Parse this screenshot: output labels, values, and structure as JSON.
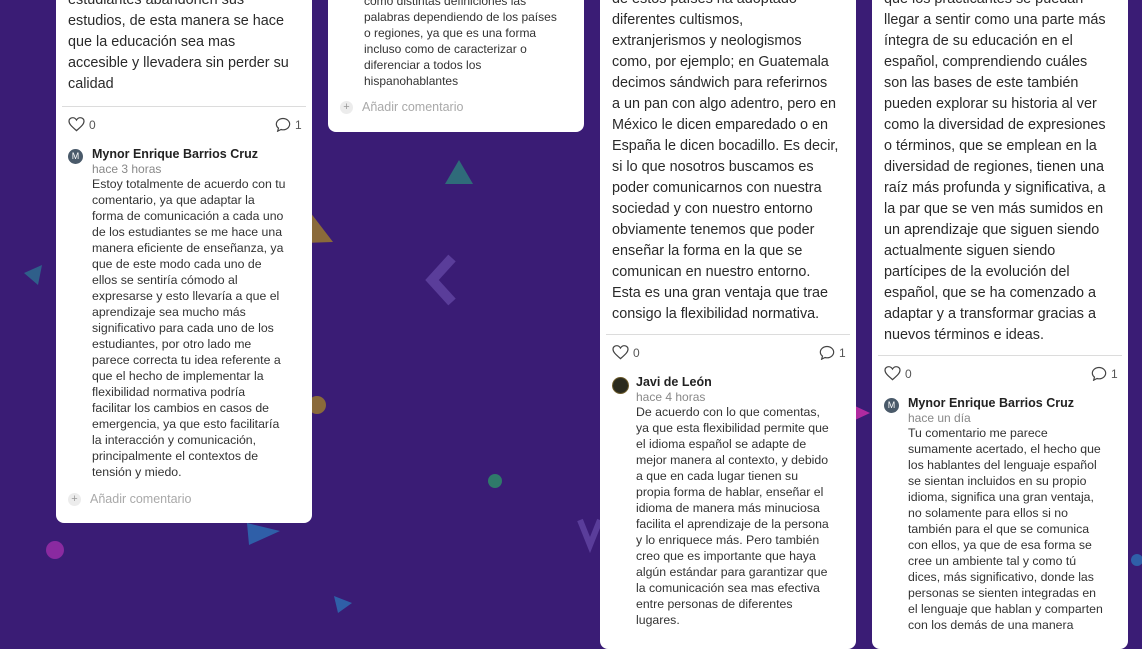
{
  "colors": {
    "background": "#3a1c75",
    "card": "#ffffff"
  },
  "cards": [
    {
      "text": "estudiantes abandonen sus\nestudios, de esta manera se hace\nque la educación sea mas\naccesible y llevadera sin perder su\ncalidad",
      "likes": "0",
      "comments_count": "1",
      "comment": {
        "avatar": "M",
        "author": "Mynor Enrique Barrios Cruz",
        "time": "hace 3 horas",
        "text": "Estoy totalmente de acuerdo con tu\ncomentario, ya que adaptar la\nforma de comunicación a cada uno\nde los estudiantes se me hace una\nmanera eficiente de enseñanza, ya\nque de este modo cada uno de\nellos se sentiría cómodo al\nexpresarse y esto llevaría a que el\naprendizaje sea  mucho más\nsignificativo para cada uno de los\nestudiantes, por otro lado me\nparece correcta tu idea referente a\nque el hecho de implementar la\nflexibilidad normativa podría\nfacilitar los cambios en casos de\nemergencia, ya que esto facilitaría\nla interacción y comunicación,\nprincipalmente el contextos de\ntensión y miedo."
      },
      "add_comment": "Añadir comentario"
    },
    {
      "text": "como distintas definiciones las\npalabras dependiendo de los países\no regiones, ya que es una forma\nincluso como de caracterizar o\ndiferenciar a todos los\nhispanohablantes",
      "add_comment": "Añadir comentario"
    },
    {
      "text": "de estos países ha adoptado\ndiferentes cultismos,\nextranjerismos y neologismos\ncomo, por ejemplo; en Guatemala\ndecimos sándwich para referirnos\na un pan con algo adentro, pero en\nMéxico le dicen emparedado o en\nEspaña le dicen bocadillo. Es decir,\nsi lo que nosotros buscamos es\npoder comunicarnos con nuestra\nsociedad y con nuestro entorno\nobviamente tenemos que poder\nenseñar la forma en la que se\ncomunican en nuestro entorno.\nEsta es una gran ventaja que trae\nconsigo la flexibilidad normativa.",
      "likes": "0",
      "comments_count": "1",
      "comment": {
        "author": "Javi de León",
        "time": "hace 4 horas",
        "text": "De acuerdo con lo que comentas,\nya que esta flexibilidad permite que\nel idioma español se adapte de\nmejor manera al contexto, y debido\na que en cada lugar tienen su\npropia forma de hablar, enseñar el\nidioma de manera más minuciosa\nfacilita el aprendizaje de la persona\ny lo enriquece más. Pero también\ncreo que es importante que haya\nalgún estándar para garantizar que\nla comunicación sea mas efectiva\nentre personas de diferentes\nlugares."
      }
    },
    {
      "text": "que los practicantes se puedan\nllegar a sentir como una parte más\níntegra de su educación en el\nespañol, comprendiendo cuáles\nson las bases de este también\npueden explorar su historia al ver\ncomo la diversidad de expresiones\no términos, que se emplean en la\ndiversidad de regiones, tienen una\nraíz más profunda y significativa, a\nla par que se ven más sumidos en\nun aprendizaje que siguen siendo\nactualmente siguen siendo\npartícipes de la evolución del\nespañol, que se ha comenzado a\nadaptar y a transformar gracias a\nnuevos términos e ideas.",
      "likes": "0",
      "comments_count": "1",
      "comment": {
        "avatar": "M",
        "author": "Mynor Enrique Barrios Cruz",
        "time": "hace un día",
        "text": "Tu comentario me parece\nsumamente acertado, el hecho que\nlos hablantes del lenguaje español\nse sientan incluidos en su propio\nidioma, significa una gran ventaja,\nno solamente para ellos si no\ntambién para el que se comunica\ncon ellos, ya que de esa forma se\ncree un ambiente tal y como tú\ndices, más significativo, donde las\npersonas se sienten integradas en\nel lenguaje que hablan y comparten\ncon los demás de una manera"
      }
    }
  ]
}
